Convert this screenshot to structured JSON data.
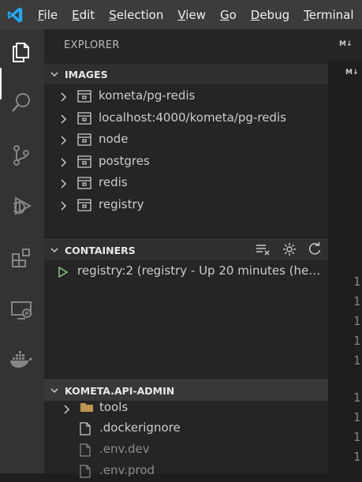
{
  "menu": {
    "items": [
      {
        "label": "File",
        "mnemonic": "F",
        "rest": "ile"
      },
      {
        "label": "Edit",
        "mnemonic": "E",
        "rest": "dit"
      },
      {
        "label": "Selection",
        "mnemonic": "S",
        "rest": "election"
      },
      {
        "label": "View",
        "mnemonic": "V",
        "rest": "iew"
      },
      {
        "label": "Go",
        "mnemonic": "G",
        "rest": "o"
      },
      {
        "label": "Debug",
        "mnemonic": "D",
        "rest": "ebug"
      },
      {
        "label": "Terminal",
        "mnemonic": "T",
        "rest": "erminal"
      }
    ]
  },
  "activity_bar": {
    "icons": [
      "explorer-icon",
      "search-icon",
      "source-control-icon",
      "debug-icon",
      "extensions-icon",
      "remote-explorer-icon",
      "docker-icon"
    ],
    "active": "explorer-icon"
  },
  "sidebar": {
    "title": "EXPLORER",
    "images": {
      "header": "IMAGES",
      "items": [
        "kometa/pg-redis",
        "localhost:4000/kometa/pg-redis",
        "node",
        "postgres",
        "redis",
        "registry"
      ]
    },
    "containers": {
      "header": "CONTAINERS",
      "items": [
        "registry:2 (registry - Up 20 minutes (heal..."
      ],
      "status_color": "#89d185"
    },
    "project": {
      "header": "KOMETA.API-ADMIN",
      "items": [
        {
          "label": "tools",
          "type": "folder"
        },
        {
          "label": ".dockerignore",
          "type": "file"
        },
        {
          "label": ".env.dev",
          "type": "file"
        },
        {
          "label": ".env.prod",
          "type": "file"
        }
      ]
    }
  },
  "editor": {
    "tab_markers": [
      "M↓",
      "M↓"
    ],
    "line_numbers": [
      "1",
      "1",
      "1",
      "1",
      "1",
      "1",
      "1",
      "1",
      "1"
    ]
  },
  "colors": {
    "accent_logo": "#23a9f2",
    "titlebar": "#3c3c3c",
    "activity_bar": "#333333",
    "sidebar": "#252526",
    "editor": "#1e1e1e"
  }
}
